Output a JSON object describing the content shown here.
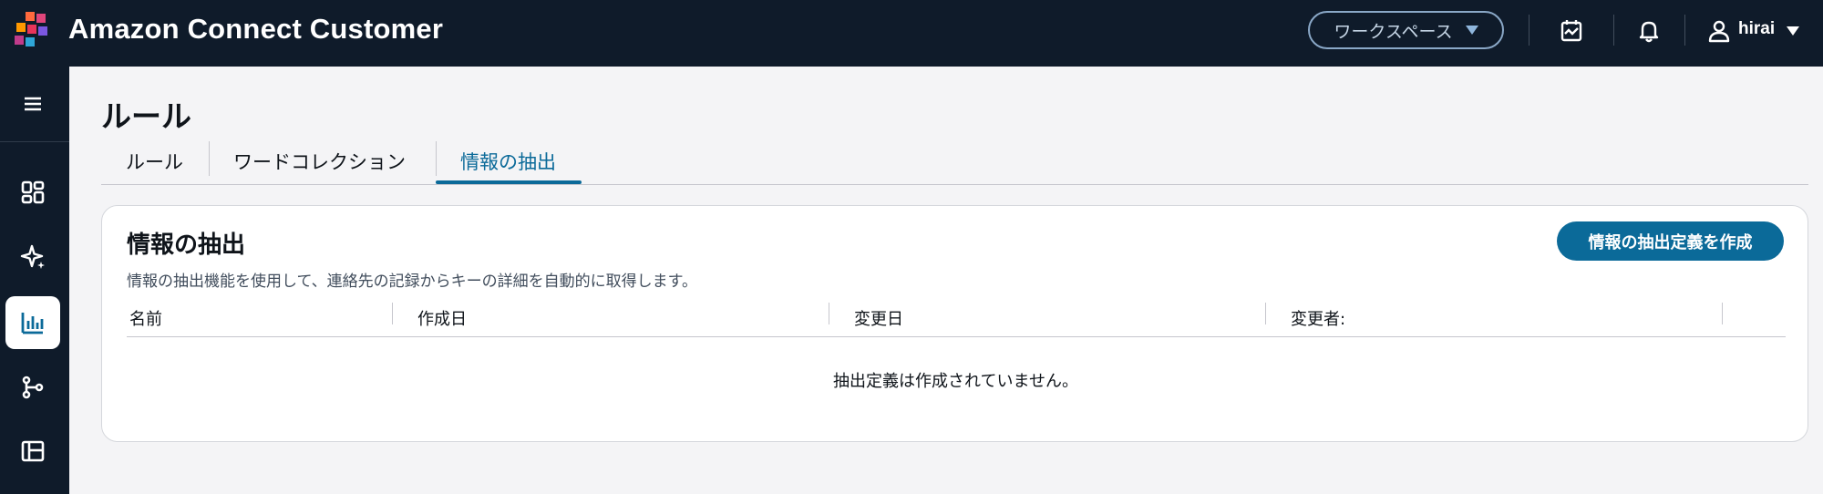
{
  "app": {
    "title": "Amazon Connect Customer"
  },
  "topbar": {
    "workspace_label": "ワークスペース",
    "user_name": "hirai",
    "icons": [
      "logo-icon",
      "calendar-icon",
      "bell-icon",
      "user-icon"
    ]
  },
  "rail": {
    "items": [
      "menu-icon",
      "dashboard-icon",
      "sparkle-icon",
      "chart-icon",
      "branch-icon",
      "layout-icon"
    ],
    "active": "chart-icon"
  },
  "page": {
    "title": "ルール",
    "tabs": [
      {
        "label": "ルール"
      },
      {
        "label": "ワードコレクション"
      },
      {
        "label": "情報の抽出"
      }
    ],
    "active_tab": "情報の抽出"
  },
  "card": {
    "title": "情報の抽出",
    "description": "情報の抽出機能を使用して、連絡先の記録からキーの詳細を自動的に取得します。",
    "create_button": "情報の抽出定義を作成",
    "columns": [
      "名前",
      "作成日",
      "変更日",
      "変更者:"
    ],
    "empty_message": "抽出定義は作成されていません。"
  },
  "colors": {
    "topbar": "#0f1b2a",
    "accent": "#0b6a99",
    "background": "#f4f4f6"
  }
}
